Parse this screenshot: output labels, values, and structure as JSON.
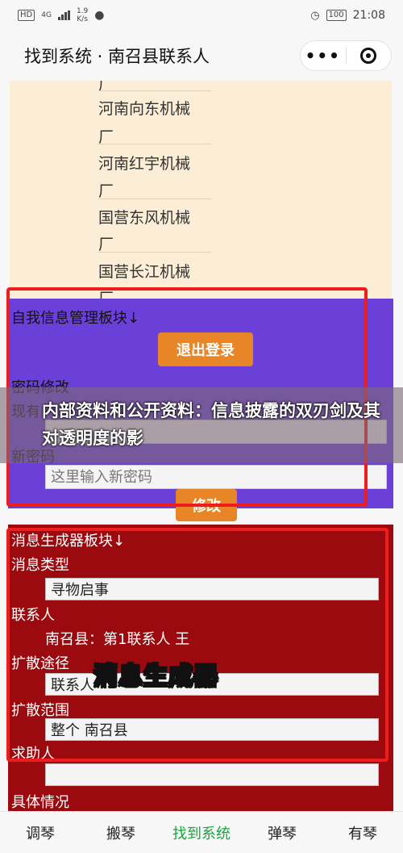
{
  "status_bar": {
    "hd": "HD",
    "network": "4G",
    "speed_value": "1.9",
    "speed_unit": "K/s",
    "battery": "100",
    "time": "21:08",
    "icons": [
      "signal-icon",
      "wifi-icon",
      "wechat-icon",
      "alarm-icon",
      "battery-icon"
    ]
  },
  "nav": {
    "title": "找到系统 · 南召县联系人",
    "more_icon": "•••",
    "close_icon": "target-icon"
  },
  "factory_list": {
    "items": [
      "河南向东机械",
      "河南红宇机械",
      "国营东风机械",
      "国营长江机械"
    ],
    "wrap_char": "厂"
  },
  "self_module": {
    "title": "自我信息管理板块↓",
    "logout_label": "退出登录",
    "password_label": "密码修改",
    "current_label": "现有",
    "new_label": "新密码",
    "new_password_placeholder": "这里输入新密码",
    "modify_label": "修改"
  },
  "banner": {
    "text": "内部资料和公开资料：信息披露的双刃剑及其对透明度的影"
  },
  "message_module": {
    "title": "消息生成器板块↓",
    "type_label": "消息类型",
    "type_value": "寻物启事",
    "contact_label": "联系人",
    "contact_value": "南召县：第1联系人 王",
    "channel_label": "扩散途径",
    "channel_value": "联系人",
    "scope_label": "扩散范围",
    "scope_value": "整个 南召县",
    "helper_label": "求助人",
    "helper_value": "",
    "detail_label": "具体情况",
    "overlay_label": "消息生成器"
  },
  "tabs": [
    {
      "label": "调琴",
      "active": false
    },
    {
      "label": "搬琴",
      "active": false
    },
    {
      "label": "找到系统",
      "active": true
    },
    {
      "label": "弹琴",
      "active": false
    },
    {
      "label": "有琴",
      "active": false
    }
  ],
  "colors": {
    "accent_green": "#17a63d",
    "purple_bg": "#6b40d8",
    "red_bg": "#9b0a0e",
    "button_orange": "#e88526",
    "highlight_red": "#ee1c1c"
  }
}
